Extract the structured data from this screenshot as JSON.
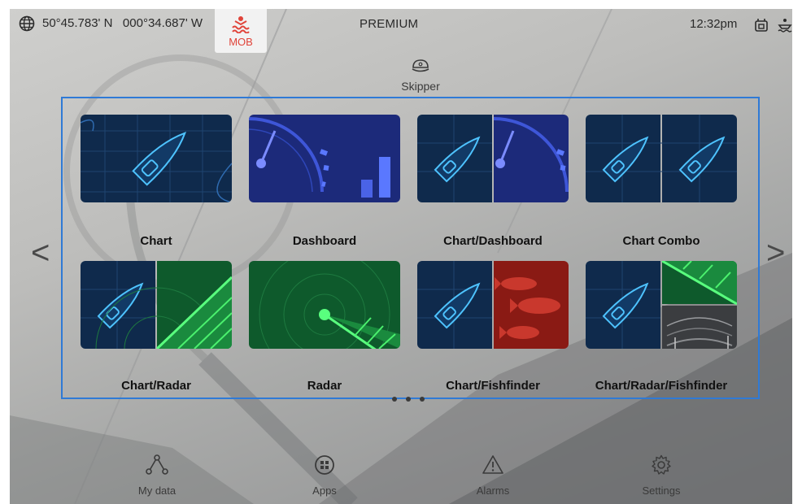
{
  "status": {
    "coords": "50°45.783' N   000°34.687' W",
    "mob_label": "MOB",
    "title": "PREMIUM",
    "time": "12:32pm"
  },
  "profile": {
    "name": "Skipper"
  },
  "apps": [
    {
      "label": "Chart"
    },
    {
      "label": "Dashboard"
    },
    {
      "label": "Chart/Dashboard"
    },
    {
      "label": "Chart Combo"
    },
    {
      "label": "Chart/Radar"
    },
    {
      "label": "Radar"
    },
    {
      "label": "Chart/Fishfinder"
    },
    {
      "label": "Chart/Radar/Fishfinder"
    }
  ],
  "nav": {
    "left_arrow": "<",
    "right_arrow": ">",
    "items": [
      {
        "label": "My data",
        "icon": "network-icon"
      },
      {
        "label": "Apps",
        "icon": "apps-icon"
      },
      {
        "label": "Alarms",
        "icon": "warning-icon"
      },
      {
        "label": "Settings",
        "icon": "gear-icon"
      }
    ]
  },
  "colors": {
    "accent": "#2f7ad6",
    "mob": "#e0443a",
    "chart_bg": "#0f2a4c",
    "radar_bg": "#0e5a2c",
    "fish_bg": "#8a1a14"
  }
}
